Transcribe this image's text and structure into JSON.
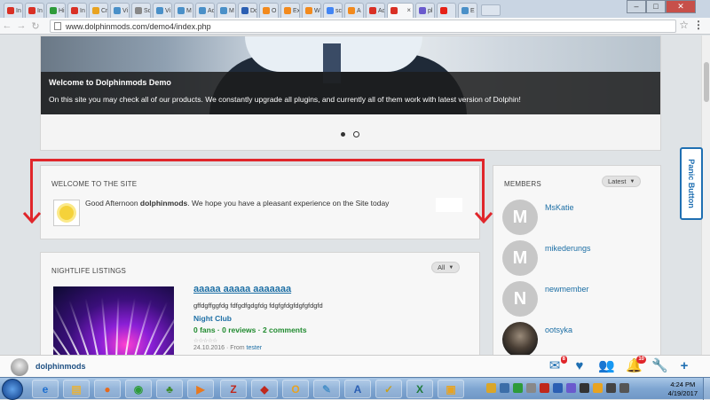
{
  "browser": {
    "tabs": [
      {
        "label": "In",
        "icon": "gmail-icon",
        "color": "#d93025"
      },
      {
        "label": "In",
        "icon": "gmail-icon",
        "color": "#d93025"
      },
      {
        "label": "Hi",
        "icon": "green-leaf-icon",
        "color": "#2e9b3a"
      },
      {
        "label": "In",
        "icon": "gmail-icon",
        "color": "#d93025"
      },
      {
        "label": "Cr",
        "icon": "folder-icon",
        "color": "#e8a321"
      },
      {
        "label": "Vi",
        "icon": "link-icon",
        "color": "#4a90c8"
      },
      {
        "label": "Sc",
        "icon": "doc-icon",
        "color": "#888888"
      },
      {
        "label": "Vi",
        "icon": "link-icon",
        "color": "#4a90c8"
      },
      {
        "label": "M",
        "icon": "link-icon",
        "color": "#4a90c8"
      },
      {
        "label": "Ac",
        "icon": "link-icon",
        "color": "#4a90c8"
      },
      {
        "label": "M",
        "icon": "link-icon",
        "color": "#4a90c8"
      },
      {
        "label": "Do",
        "icon": "blue-d-icon",
        "color": "#2b5fb3"
      },
      {
        "label": "O",
        "icon": "orange-o-icon",
        "color": "#f28a1e"
      },
      {
        "label": "Ex",
        "icon": "orange-o-icon",
        "color": "#f28a1e"
      },
      {
        "label": "W",
        "icon": "orange-o-icon",
        "color": "#f28a1e"
      },
      {
        "label": "sc",
        "icon": "google-icon",
        "color": "#4285f4"
      },
      {
        "label": "A",
        "icon": "orange-o-icon",
        "color": "#f28a1e"
      },
      {
        "label": "Ac",
        "icon": "red-bars-icon",
        "color": "#d93025"
      }
    ],
    "active_tab": {
      "label": "",
      "icon": "red-bars-icon",
      "color": "#d93025"
    },
    "tabs_after": [
      {
        "label": "pl",
        "icon": "triangle-icon",
        "color": "#6a5acd"
      },
      {
        "label": "",
        "icon": "youtube-icon",
        "color": "#e62117"
      },
      {
        "label": "E",
        "icon": "globe-icon",
        "color": "#4a90c8"
      }
    ],
    "url": "www.dolphinmods.com/demo4/index.php",
    "window_controls": {
      "minimize": "–",
      "maximize": "□",
      "close": "✕"
    }
  },
  "slider": {
    "caption_title": "Welcome to Dolphinmods Demo",
    "caption_text": "On this site you may check all of our products. We constantly upgrade all plugins, and currently all of them work with latest version of Dolphin!"
  },
  "welcome": {
    "title": "WELCOME TO THE SITE",
    "greeting_pre": "Good Afternoon ",
    "username": "dolphinmods",
    "greeting_post": ". We hope you have a pleasant experience on the Site today"
  },
  "nightlife": {
    "title": "NIGHTLIFE LISTINGS",
    "filter": "All",
    "listing": {
      "title": "aaaaa aaaaa aaaaaaa",
      "description": "gffdgffggfdg fdfgdfgdgfdg fdgfgfdgfdgfgfdgfd",
      "category": "Night Club",
      "stats": "0 fans · 0 reviews · 2 comments",
      "stars": "☆☆☆☆☆",
      "date": "24.10.2016 · From ",
      "author": "tester"
    }
  },
  "members": {
    "title": "MEMBERS",
    "filter": "Latest",
    "items": [
      {
        "name": "MsKatie",
        "initial": "M"
      },
      {
        "name": "mikederungs",
        "initial": "M"
      },
      {
        "name": "newmember",
        "initial": "N"
      },
      {
        "name": "ootsyka",
        "initial": ""
      }
    ]
  },
  "panic_button": "Panic Button",
  "footer": {
    "username": "dolphinmods",
    "mail_badge": "8",
    "notif_badge": "10"
  },
  "taskbar": {
    "time": "4:24 PM",
    "date": "4/19/2017"
  }
}
